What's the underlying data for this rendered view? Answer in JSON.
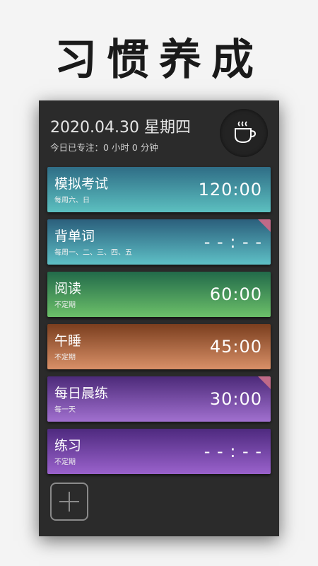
{
  "banner": {
    "title": "习惯养成"
  },
  "header": {
    "date": "2020.04.30 星期四",
    "focus": "今日已专注：0 小时 0 分钟",
    "coffee_icon": "coffee-cup-icon"
  },
  "habits": [
    {
      "name": "模拟考试",
      "schedule": "每周六、日",
      "time": "120:00",
      "color_top": "#2f6d86",
      "color_bottom": "#5cc0c0",
      "corner": false
    },
    {
      "name": "背单词",
      "schedule": "每周一、二、三、四、五",
      "time": "- - : - -",
      "color_top": "#2b5f7c",
      "color_bottom": "#5ec0c6",
      "corner": true
    },
    {
      "name": "阅读",
      "schedule": "不定期",
      "time": "60:00",
      "color_top": "#226a4a",
      "color_bottom": "#6cc069",
      "corner": false
    },
    {
      "name": "午睡",
      "schedule": "不定期",
      "time": "45:00",
      "color_top": "#7a3e1e",
      "color_bottom": "#d99068",
      "corner": false
    },
    {
      "name": "每日晨练",
      "schedule": "每一天",
      "time": "30:00",
      "color_top": "#4c2a79",
      "color_bottom": "#a170cf",
      "corner": true
    },
    {
      "name": "练习",
      "schedule": "不定期",
      "time": "- - : - -",
      "color_top": "#4e2a7f",
      "color_bottom": "#9a62cc",
      "corner": false
    }
  ],
  "add_button": {
    "icon": "plus-icon"
  }
}
